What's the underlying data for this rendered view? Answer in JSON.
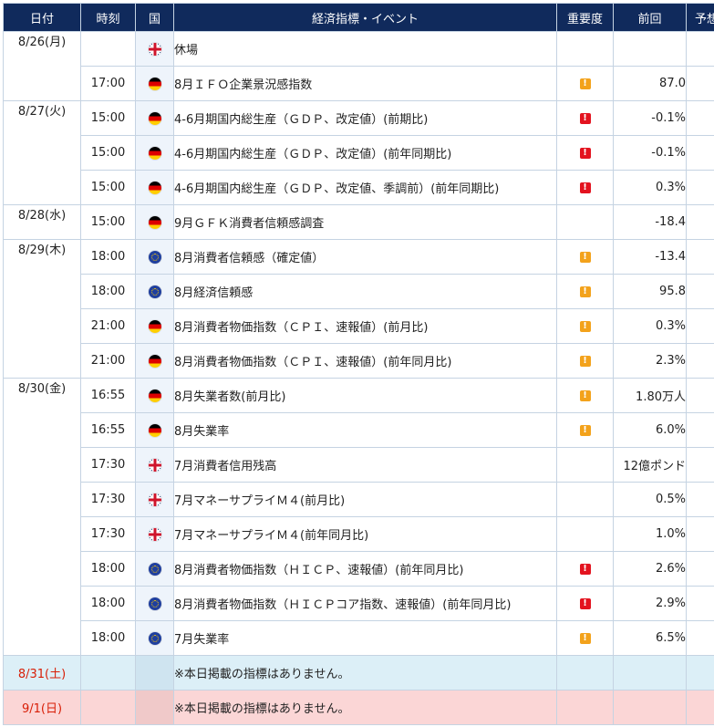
{
  "header": {
    "date": "日付",
    "time": "時刻",
    "country": "国",
    "event": "経済指標・イベント",
    "importance": "重要度",
    "previous": "前回",
    "forecast": "予想"
  },
  "colors": {
    "header_bg": "#102a5c",
    "importance_mid": "#f3a21b",
    "importance_high": "#e3131f",
    "saturday_bg": "#dceff7",
    "sunday_bg": "#fbd6d6",
    "weekend_date": "#d81e06"
  },
  "days": [
    {
      "date": "8/26(月)",
      "rows": [
        {
          "time": "",
          "country": "uk-flag-icon",
          "event": "休場",
          "importance": "",
          "previous": ""
        },
        {
          "time": "17:00",
          "country": "germany-flag-icon",
          "event": "8月ＩＦＯ企業景況感指数",
          "importance": "!",
          "importance_level": "mid",
          "previous": "87.0"
        }
      ]
    },
    {
      "date": "8/27(火)",
      "rows": [
        {
          "time": "15:00",
          "country": "germany-flag-icon",
          "event": "4-6月期国内総生産（ＧＤＰ、改定値）(前期比)",
          "importance": "!",
          "importance_level": "high",
          "previous": "-0.1%"
        },
        {
          "time": "15:00",
          "country": "germany-flag-icon",
          "event": "4-6月期国内総生産（ＧＤＰ、改定値）(前年同期比)",
          "importance": "!",
          "importance_level": "high",
          "previous": "-0.1%"
        },
        {
          "time": "15:00",
          "country": "germany-flag-icon",
          "event": "4-6月期国内総生産（ＧＤＰ、改定値、季調前）(前年同期比)",
          "importance": "!",
          "importance_level": "high",
          "previous": "0.3%"
        }
      ]
    },
    {
      "date": "8/28(水)",
      "rows": [
        {
          "time": "15:00",
          "country": "germany-flag-icon",
          "event": "9月ＧＦＫ消費者信頼感調査",
          "importance": "",
          "previous": "-18.4"
        }
      ]
    },
    {
      "date": "8/29(木)",
      "rows": [
        {
          "time": "18:00",
          "country": "eu-flag-icon",
          "event": "8月消費者信頼感（確定値）",
          "importance": "!",
          "importance_level": "mid",
          "previous": "-13.4"
        },
        {
          "time": "18:00",
          "country": "eu-flag-icon",
          "event": "8月経済信頼感",
          "importance": "!",
          "importance_level": "mid",
          "previous": "95.8"
        },
        {
          "time": "21:00",
          "country": "germany-flag-icon",
          "event": "8月消費者物価指数（ＣＰＩ、速報値）(前月比)",
          "importance": "!",
          "importance_level": "mid",
          "previous": "0.3%"
        },
        {
          "time": "21:00",
          "country": "germany-flag-icon",
          "event": "8月消費者物価指数（ＣＰＩ、速報値）(前年同月比)",
          "importance": "!",
          "importance_level": "mid",
          "previous": "2.3%"
        }
      ]
    },
    {
      "date": "8/30(金)",
      "rows": [
        {
          "time": "16:55",
          "country": "germany-flag-icon",
          "event": "8月失業者数(前月比)",
          "importance": "!",
          "importance_level": "mid",
          "previous": "1.80万人"
        },
        {
          "time": "16:55",
          "country": "germany-flag-icon",
          "event": "8月失業率",
          "importance": "!",
          "importance_level": "mid",
          "previous": "6.0%"
        },
        {
          "time": "17:30",
          "country": "uk-flag-icon",
          "event": "7月消費者信用残高",
          "importance": "",
          "previous": "12億ポンド"
        },
        {
          "time": "17:30",
          "country": "uk-flag-icon",
          "event": "7月マネーサプライＭ４(前月比)",
          "importance": "",
          "previous": "0.5%"
        },
        {
          "time": "17:30",
          "country": "uk-flag-icon",
          "event": "7月マネーサプライＭ４(前年同月比)",
          "importance": "",
          "previous": "1.0%"
        },
        {
          "time": "18:00",
          "country": "eu-flag-icon",
          "event": "8月消費者物価指数（ＨＩＣＰ、速報値）(前年同月比)",
          "importance": "!",
          "importance_level": "high",
          "previous": "2.6%"
        },
        {
          "time": "18:00",
          "country": "eu-flag-icon",
          "event": "8月消費者物価指数（ＨＩＣＰコア指数、速報値）(前年同月比)",
          "importance": "!",
          "importance_level": "high",
          "previous": "2.9%"
        },
        {
          "time": "18:00",
          "country": "eu-flag-icon",
          "event": "7月失業率",
          "importance": "!",
          "importance_level": "mid",
          "previous": "6.5%"
        }
      ]
    },
    {
      "date": "8/31(土)",
      "weekend": "sat",
      "rows": [
        {
          "time": "",
          "country": "",
          "event": "※本日掲載の指標はありません。",
          "importance": "",
          "previous": ""
        }
      ]
    },
    {
      "date": "9/1(日)",
      "weekend": "sun",
      "rows": [
        {
          "time": "",
          "country": "",
          "event": "※本日掲載の指標はありません。",
          "importance": "",
          "previous": ""
        }
      ]
    }
  ]
}
